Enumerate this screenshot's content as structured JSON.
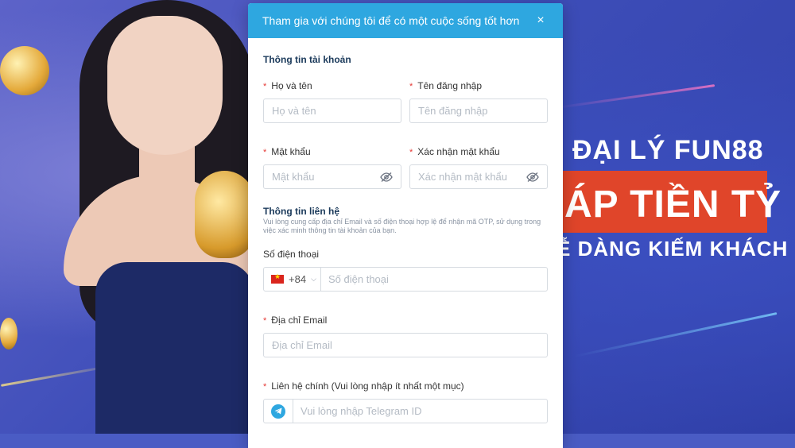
{
  "background": {
    "promo_line1": "ĐẠI LÝ FUN88",
    "promo_line2": "ÁP TIỀN TỶ",
    "promo_line3": "Ễ DÀNG KIẾM KHÁCH"
  },
  "modal": {
    "title": "Tham gia với chúng tôi để có một cuộc sống tốt hơn",
    "close_icon": "×",
    "account_section": "Thông tin tài khoản",
    "fullname": {
      "label": "Họ và tên",
      "placeholder": "Họ và tên"
    },
    "username": {
      "label": "Tên đăng nhập",
      "placeholder": "Tên đăng nhập"
    },
    "password": {
      "label": "Mật khẩu",
      "placeholder": "Mật khẩu"
    },
    "confirm_password": {
      "label": "Xác nhận mật khẩu",
      "placeholder": "Xác nhận mật khẩu"
    },
    "contact_section": "Thông tin liên hệ",
    "contact_hint": "Vui lòng cung cấp địa chỉ Email và số điện thoại hợp lệ để nhận mã OTP, sử dụng trong việc xác minh thông tin tài khoản của bạn.",
    "phone": {
      "label": "Số điện thoại",
      "country_code": "+84",
      "placeholder": "Số điện thoại"
    },
    "email": {
      "label": "Địa chỉ Email",
      "placeholder": "Địa chỉ Email"
    },
    "main_contact": {
      "label": "Liên hệ chính (Vui lòng nhập ít nhất một mục)",
      "placeholder": "Vui lòng nhập Telegram ID"
    },
    "required_mark": "*"
  },
  "colors": {
    "header": "#2ea7e0",
    "required": "#e53935",
    "promo_box": "#e0452a"
  }
}
